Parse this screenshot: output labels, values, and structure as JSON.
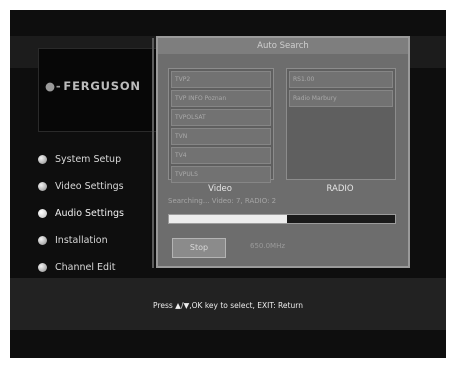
{
  "logo": {
    "text": "FERGUSON",
    "icon": "ferguson-logo-mark"
  },
  "menu": {
    "items": [
      {
        "label": "System Setup",
        "active": false
      },
      {
        "label": "Video Settings",
        "active": false
      },
      {
        "label": "Audio Settings",
        "active": true
      },
      {
        "label": "Installation",
        "active": false
      },
      {
        "label": "Channel Edit",
        "active": false
      }
    ]
  },
  "panel": {
    "title": "Auto Search",
    "video_channels": [
      "TVP2",
      "TVP INFO Poznan",
      "TVPOLSAT",
      "TVN",
      "TV4",
      "TVPULS"
    ],
    "radio_channels": [
      "RS1.00",
      "Radio Marbury"
    ],
    "video_label": "Video",
    "radio_label": "RADIO",
    "status": "Searching...  Video: 7, RADIO: 2",
    "progress": 0.52,
    "stop_label": "Stop",
    "frequency": "650.0MHz"
  },
  "footer": {
    "text": "Press ▲/▼,OK key to select, EXIT: Return"
  },
  "colors": {
    "screen_bg": "#0e0e0e",
    "panel_bg": "#6d6d6d",
    "progress_fill": "#ededed"
  }
}
